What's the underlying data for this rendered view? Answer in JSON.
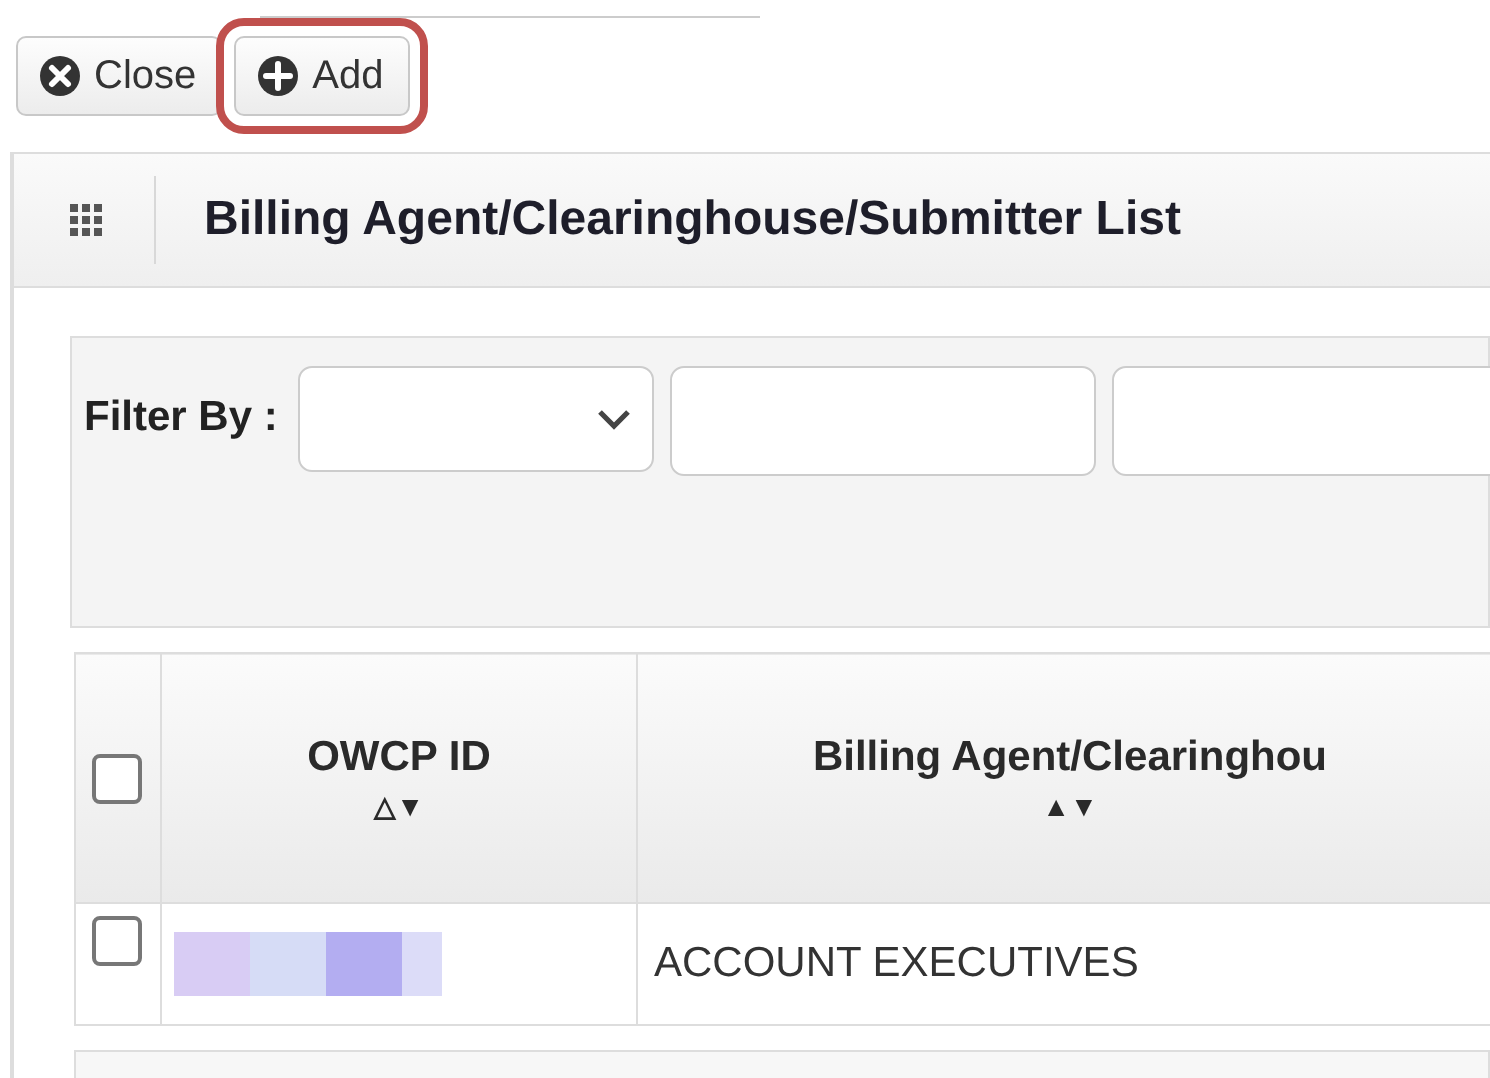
{
  "toolbar": {
    "buttons": [
      {
        "kind": "close",
        "label": "Close",
        "highlighted": false
      },
      {
        "kind": "add",
        "label": "Add",
        "highlighted": true
      }
    ]
  },
  "header": {
    "title": "Billing Agent/Clearinghouse/Submitter List"
  },
  "filter": {
    "label": "Filter By :"
  },
  "table": {
    "select_all": {
      "checked": false
    },
    "columns": [
      {
        "title": "OWCP ID",
        "sort": "△▼"
      },
      {
        "title": "Billing Agent/Clearinghou",
        "sort": "▲▼"
      }
    ],
    "rows": [
      {
        "checked": false,
        "owcp_id_redacted": true,
        "name": "ACCOUNT EXECUTIVES"
      }
    ]
  }
}
